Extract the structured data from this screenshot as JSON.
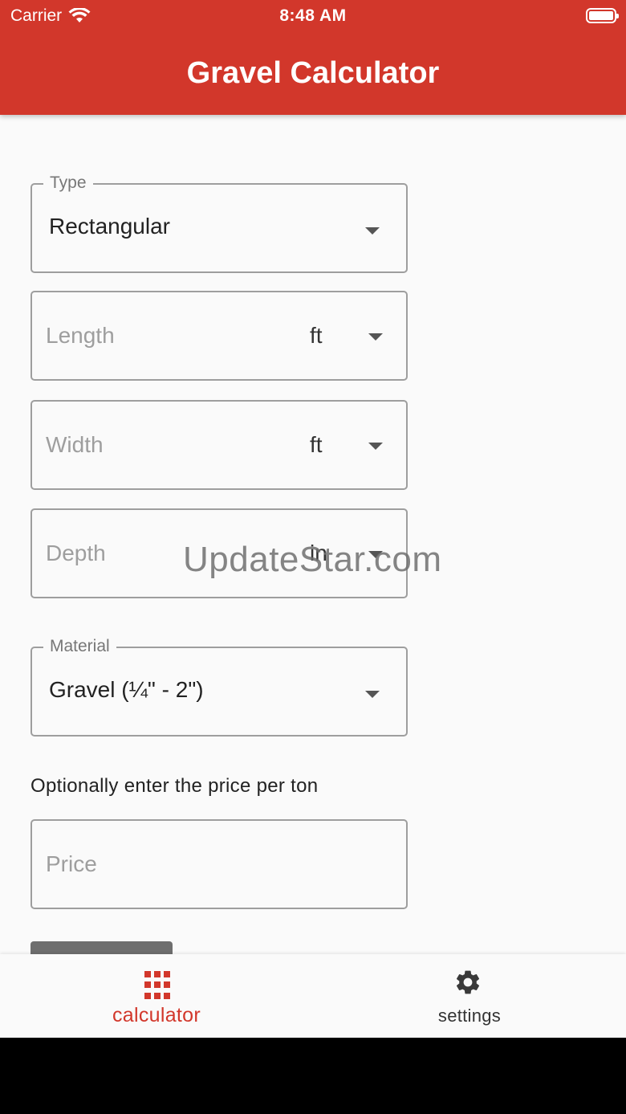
{
  "status_bar": {
    "carrier": "Carrier",
    "time": "8:48 AM",
    "wifi_icon": "wifi-icon",
    "battery_icon": "battery-icon"
  },
  "app_bar": {
    "title": "Gravel Calculator"
  },
  "form": {
    "type": {
      "label": "Type",
      "value": "Rectangular"
    },
    "length": {
      "placeholder": "Length",
      "unit": "ft"
    },
    "width": {
      "placeholder": "Width",
      "unit": "ft"
    },
    "depth": {
      "placeholder": "Depth",
      "unit": "in"
    },
    "material": {
      "label": "Material",
      "value": "Gravel (¼\" - 2\")"
    },
    "price_caption": "Optionally enter the price per ton",
    "price": {
      "placeholder": "Price"
    }
  },
  "watermark": "UpdateStar.com",
  "bottom_nav": {
    "items": [
      {
        "label": "calculator",
        "icon": "grid-icon",
        "active": true
      },
      {
        "label": "settings",
        "icon": "gear-icon",
        "active": false
      }
    ]
  },
  "colors": {
    "primary": "#d2372b",
    "background": "#fafafa",
    "inactive": "#333333"
  }
}
